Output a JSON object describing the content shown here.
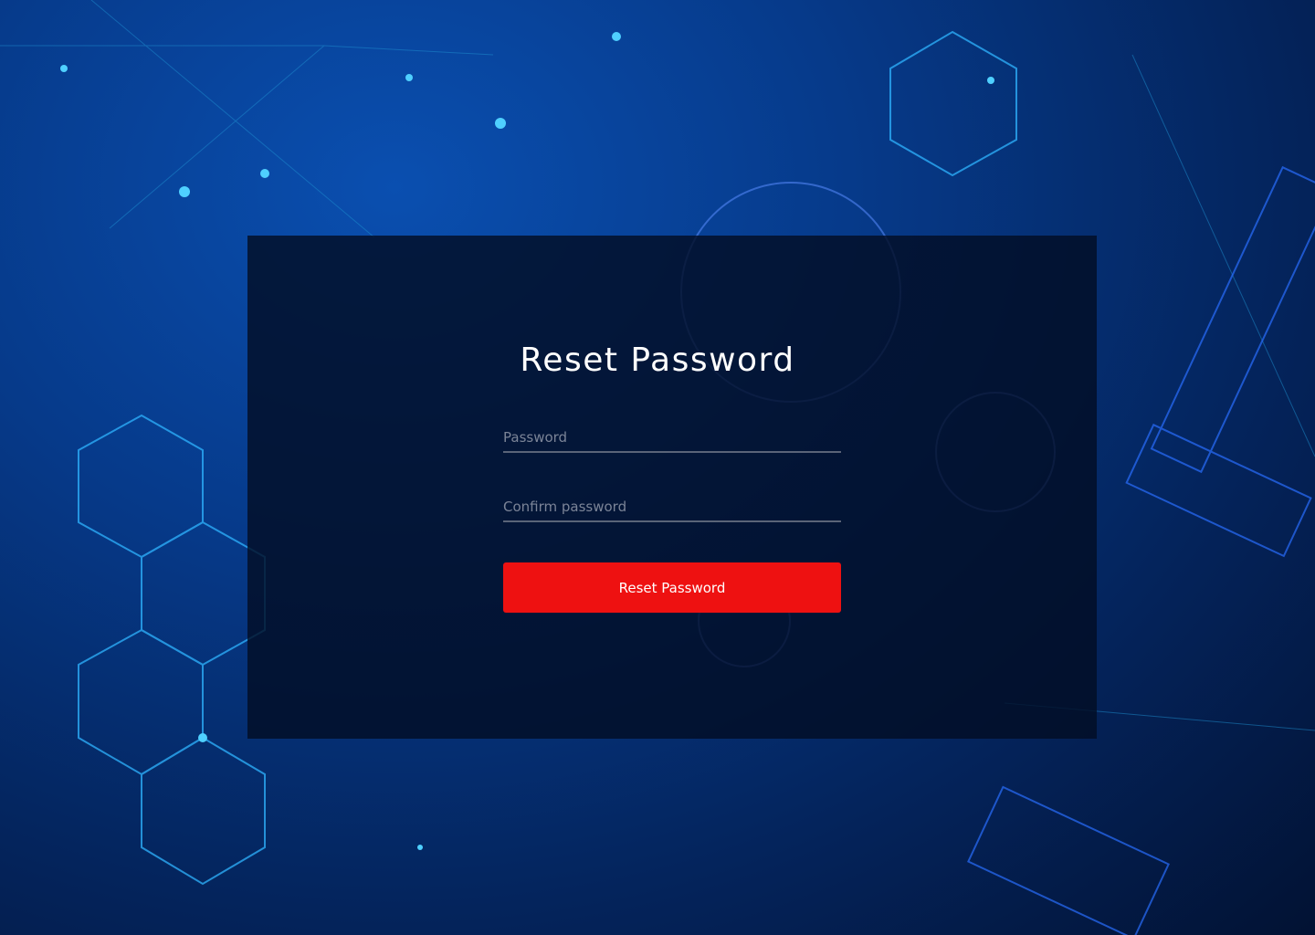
{
  "form": {
    "title": "Reset Password",
    "password_placeholder": "Password",
    "password_value": "",
    "confirm_placeholder": "Confirm password",
    "confirm_value": "",
    "submit_label": "Reset Password"
  },
  "colors": {
    "accent": "#ee1111",
    "background": "#063a8a"
  }
}
